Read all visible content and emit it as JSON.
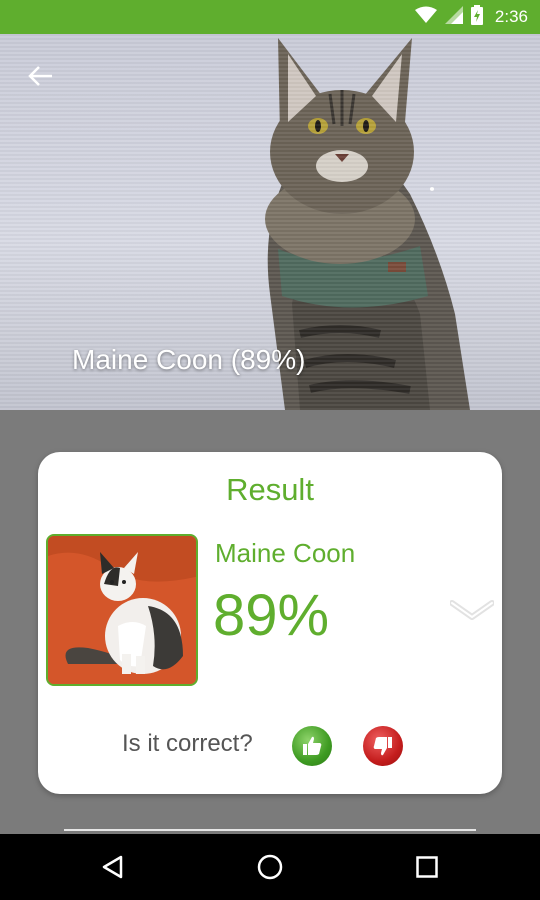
{
  "status_bar": {
    "time": "2:36",
    "icons": [
      "wifi-icon",
      "cell-signal-icon",
      "battery-charging-icon"
    ]
  },
  "photo": {
    "caption": "Maine Coon (89%)",
    "back_icon": "arrow-left-icon"
  },
  "result_card": {
    "title": "Result",
    "breed": "Maine Coon",
    "confidence": "89%",
    "expand_icon": "chevron-down-icon",
    "feedback_question": "Is it correct?",
    "feedback_buttons": [
      "thumbs-up-icon",
      "thumbs-down-icon"
    ]
  },
  "nav_bar": {
    "buttons": [
      "back-triangle-icon",
      "home-circle-icon",
      "recents-square-icon"
    ]
  },
  "colors": {
    "accent": "#5fae2e",
    "status_bar": "#5fae2e",
    "background": "#7b7b7b",
    "card": "#ffffff",
    "thumbs_up": "#3e9b22",
    "thumbs_down": "#c41d1d"
  }
}
